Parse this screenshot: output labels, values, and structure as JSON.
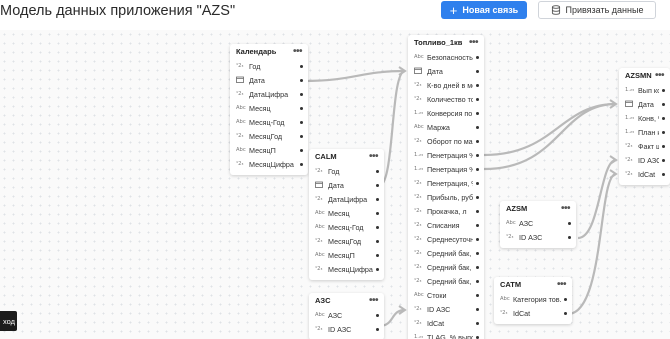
{
  "header": {
    "title": "Модель данных приложения \"AZS\"",
    "new_link_label": "Новая связь",
    "bind_data_label": "Привязать данные"
  },
  "toast": {
    "text": "ход"
  },
  "tables": [
    {
      "name": "Календарь",
      "fields": [
        {
          "label": "Год",
          "icon": "123"
        },
        {
          "label": "Дата",
          "icon": "cal"
        },
        {
          "label": "ДатаЦифра",
          "icon": "123"
        },
        {
          "label": "Месяц",
          "icon": "Abc"
        },
        {
          "label": "Месяц-Год",
          "icon": "Abc"
        },
        {
          "label": "МесяцГод",
          "icon": "123"
        },
        {
          "label": "МесяцП",
          "icon": "Abc"
        },
        {
          "label": "МесяцЦифра",
          "icon": "123"
        }
      ]
    },
    {
      "name": "CALM",
      "fields": [
        {
          "label": "Год",
          "icon": "123"
        },
        {
          "label": "Дата",
          "icon": "cal"
        },
        {
          "label": "ДатаЦифра",
          "icon": "123"
        },
        {
          "label": "Месяц",
          "icon": "Abc"
        },
        {
          "label": "Месяц-Год",
          "icon": "Abc"
        },
        {
          "label": "МесяцГод",
          "icon": "123"
        },
        {
          "label": "МесяцП",
          "icon": "Abc"
        },
        {
          "label": "МесяцЦифра",
          "icon": "123"
        }
      ]
    },
    {
      "name": "AЗC",
      "fields": [
        {
          "label": "АЗС",
          "icon": "Abc"
        },
        {
          "label": "ID АЗС",
          "icon": "123"
        }
      ]
    },
    {
      "name": "Топливо_1кв",
      "fields": [
        {
          "label": "Безопасность",
          "icon": "Abc"
        },
        {
          "label": "Дата",
          "icon": "cal"
        },
        {
          "label": "К-во дней в ме...",
          "icon": "123"
        },
        {
          "label": "Количество то...",
          "icon": "123"
        },
        {
          "label": "Конверсия по ...",
          "icon": "1.23"
        },
        {
          "label": "Маржа",
          "icon": "Abc"
        },
        {
          "label": "Оборот по маг...",
          "icon": "123"
        },
        {
          "label": "Пенетрация % ...",
          "icon": "1.23"
        },
        {
          "label": "Пенетрация % ...",
          "icon": "1.23"
        },
        {
          "label": "Пенетрация, %...",
          "icon": "123"
        },
        {
          "label": "Прибыль, руб",
          "icon": "123"
        },
        {
          "label": "Прокачка, л",
          "icon": "123"
        },
        {
          "label": "Списания",
          "icon": "123"
        },
        {
          "label": "Среднесуточн...",
          "icon": "123"
        },
        {
          "label": "Средний бак, ...",
          "icon": "123"
        },
        {
          "label": "Средний бак, ...",
          "icon": "123"
        },
        {
          "label": "Средний бак, ...",
          "icon": "123"
        },
        {
          "label": "Стоки",
          "icon": "Abc"
        },
        {
          "label": "ID АЗС",
          "icon": "123"
        },
        {
          "label": "IdCat",
          "icon": "123"
        },
        {
          "label": "TLAG_% выпол...",
          "icon": "1.23"
        }
      ]
    },
    {
      "name": "AZSM",
      "fields": [
        {
          "label": "АЗС",
          "icon": "Abc"
        },
        {
          "label": "ID АЗС",
          "icon": "123"
        }
      ]
    },
    {
      "name": "CATM",
      "fields": [
        {
          "label": "Категория тов...",
          "icon": "Abc"
        },
        {
          "label": "IdCat",
          "icon": "123"
        }
      ]
    },
    {
      "name": "AZSMN",
      "fields": [
        {
          "label": "Вып конв",
          "icon": "1.23"
        },
        {
          "label": "Дата",
          "icon": "cal"
        },
        {
          "label": "Конв, %",
          "icon": "1.23"
        },
        {
          "label": "План конв",
          "icon": "1.23"
        },
        {
          "label": "Факт шт.",
          "icon": "123"
        },
        {
          "label": "ID АЗС",
          "icon": "123"
        },
        {
          "label": "IdCat",
          "icon": "123"
        }
      ]
    }
  ],
  "colors": {
    "accent": "#2f80ed",
    "link": "#b9b9b9",
    "toast_bg": "#1c1c1c"
  }
}
